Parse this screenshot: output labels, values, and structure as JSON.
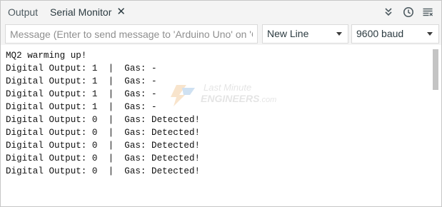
{
  "tabs": {
    "output_label": "Output",
    "serial_monitor_label": "Serial Monitor",
    "close_glyph": "✕"
  },
  "toolbar": {
    "icons": [
      "toggle-autoscroll-icon",
      "toggle-timestamp-icon",
      "clear-output-icon"
    ]
  },
  "message_input": {
    "value": "",
    "placeholder": "Message (Enter to send message to 'Arduino Uno' on 'CO…"
  },
  "line_ending": {
    "selected": "New Line"
  },
  "baud_rate": {
    "selected": "9600 baud"
  },
  "serial_output": [
    "MQ2 warming up!",
    "Digital Output: 1  |  Gas: -",
    "Digital Output: 1  |  Gas: -",
    "Digital Output: 1  |  Gas: -",
    "Digital Output: 1  |  Gas: -",
    "Digital Output: 0  |  Gas: Detected!",
    "Digital Output: 0  |  Gas: Detected!",
    "Digital Output: 0  |  Gas: Detected!",
    "Digital Output: 0  |  Gas: Detected!",
    "Digital Output: 0  |  Gas: Detected!"
  ],
  "watermark": {
    "line1": "Last Minute",
    "line2": "ENGINEERS",
    "suffix": ".com"
  },
  "colors": {
    "toolbar_bg": "#f4f4f4",
    "border": "#c7c7c7",
    "text": "#111111",
    "icon": "#4e5b61"
  }
}
